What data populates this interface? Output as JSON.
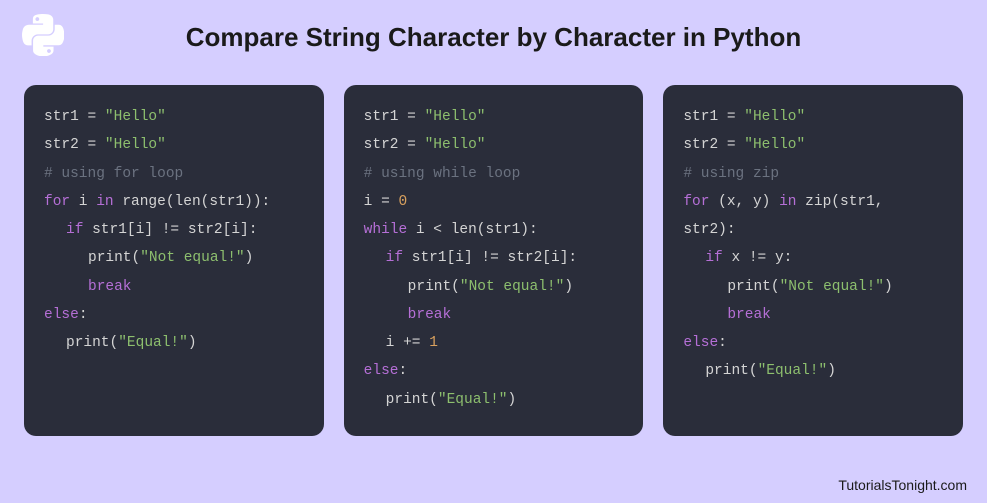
{
  "title": "Compare String Character by Character in Python",
  "footer": "TutorialsTonight.com",
  "blocks": {
    "b1": {
      "l1_a": "str1 = ",
      "l1_b": "\"Hello\"",
      "l2_a": "str2 = ",
      "l2_b": "\"Hello\"",
      "l3": "# using for loop",
      "l4_a": "for",
      "l4_b": " i ",
      "l4_c": "in",
      "l4_d": " range(len(str1)):",
      "l5_a": "if",
      "l5_b": " str1[i] != str2[i]:",
      "l6_a": "print(",
      "l6_b": "\"Not equal!\"",
      "l6_c": ")",
      "l7": "break",
      "l8_a": "else",
      "l8_b": ":",
      "l9_a": "print(",
      "l9_b": "\"Equal!\"",
      "l9_c": ")"
    },
    "b2": {
      "l1_a": "str1 = ",
      "l1_b": "\"Hello\"",
      "l2_a": "str2 = ",
      "l2_b": "\"Hello\"",
      "l3": "# using while loop",
      "l4_a": "i = ",
      "l4_b": "0",
      "l5_a": "while",
      "l5_b": " i < len(str1):",
      "l6_a": "if",
      "l6_b": " str1[i] != str2[i]:",
      "l7_a": "print(",
      "l7_b": "\"Not equal!\"",
      "l7_c": ")",
      "l8": "break",
      "l9_a": "i += ",
      "l9_b": "1",
      "l10_a": "else",
      "l10_b": ":",
      "l11_a": "print(",
      "l11_b": "\"Equal!\"",
      "l11_c": ")"
    },
    "b3": {
      "l1_a": "str1 = ",
      "l1_b": "\"Hello\"",
      "l2_a": "str2 = ",
      "l2_b": "\"Hello\"",
      "l3": "# using zip",
      "l4_a": "for",
      "l4_b": " (x, y) ",
      "l4_c": "in",
      "l4_d": " zip(str1,",
      "l5": "str2):",
      "l6_a": "if",
      "l6_b": " x != y:",
      "l7_a": "print(",
      "l7_b": "\"Not equal!\"",
      "l7_c": ")",
      "l8": "break",
      "l9_a": "else",
      "l9_b": ":",
      "l10_a": "print(",
      "l10_b": "\"Equal!\"",
      "l10_c": ")"
    }
  }
}
